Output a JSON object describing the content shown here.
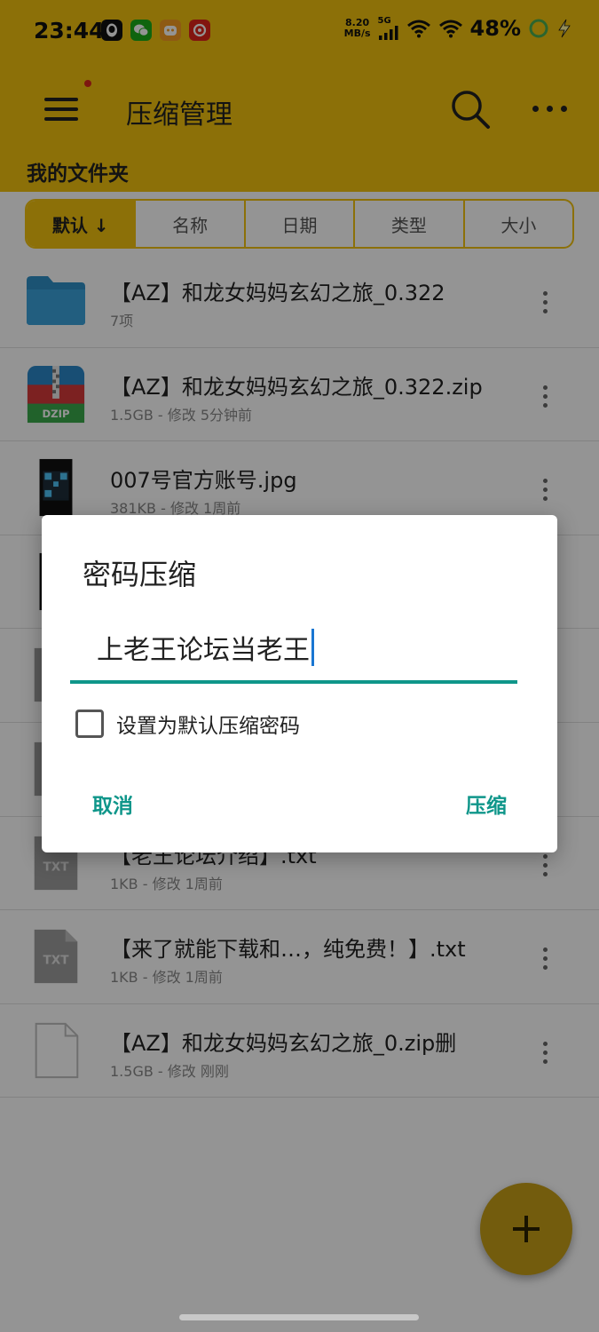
{
  "status_bar": {
    "time": "23:44",
    "net_speed_value": "8.20",
    "net_speed_unit": "MB/s",
    "network": "5G",
    "battery": "48%",
    "app_icons": [
      "qq-icon",
      "wechat-icon",
      "game-app-icon",
      "netease-music-icon"
    ]
  },
  "toolbar": {
    "title": "压缩管理"
  },
  "breadcrumb": "我的文件夹",
  "sort_tabs": [
    "默认 ↓",
    "名称",
    "日期",
    "类型",
    "大小"
  ],
  "files": [
    {
      "name": "【AZ】和龙女妈妈玄幻之旅_0.322",
      "meta": "7项",
      "icon": "folder-icon"
    },
    {
      "name": "【AZ】和龙女妈妈玄幻之旅_0.322.zip",
      "meta": "1.5GB - 修改 5分钟前",
      "icon": "dzip-archive-icon",
      "icon_label": "DZIP"
    },
    {
      "name": "007号官方账号.jpg",
      "meta": "381KB - 修改 1周前",
      "icon": "image-thumbnail-icon"
    },
    {
      "name": "",
      "meta": "",
      "icon": "image-thumbnail-icon"
    },
    {
      "name": "",
      "meta": "",
      "icon": "file-icon"
    },
    {
      "name": "",
      "meta": "",
      "icon": "file-icon"
    },
    {
      "name": "【老王论坛介绍】.txt",
      "meta": "1KB - 修改 1周前",
      "icon": "txt-file-icon",
      "icon_label": "TXT"
    },
    {
      "name": "【来了就能下载和…，纯免费！】.txt",
      "meta": "1KB - 修改 1周前",
      "icon": "txt-file-icon",
      "icon_label": "TXT"
    },
    {
      "name": "【AZ】和龙女妈妈玄幻之旅_0.zip删",
      "meta": "1.5GB - 修改 刚刚",
      "icon": "blank-file-icon"
    }
  ],
  "dialog": {
    "title": "密码压缩",
    "password_value": "上老王论坛当老王",
    "checkbox_label": "设置为默认压缩密码",
    "checkbox_checked": false,
    "cancel_label": "取消",
    "confirm_label": "压缩"
  },
  "colors": {
    "accent": "#f2c20f",
    "dialog_accent": "#0f968a",
    "fab": "#c69f18"
  }
}
